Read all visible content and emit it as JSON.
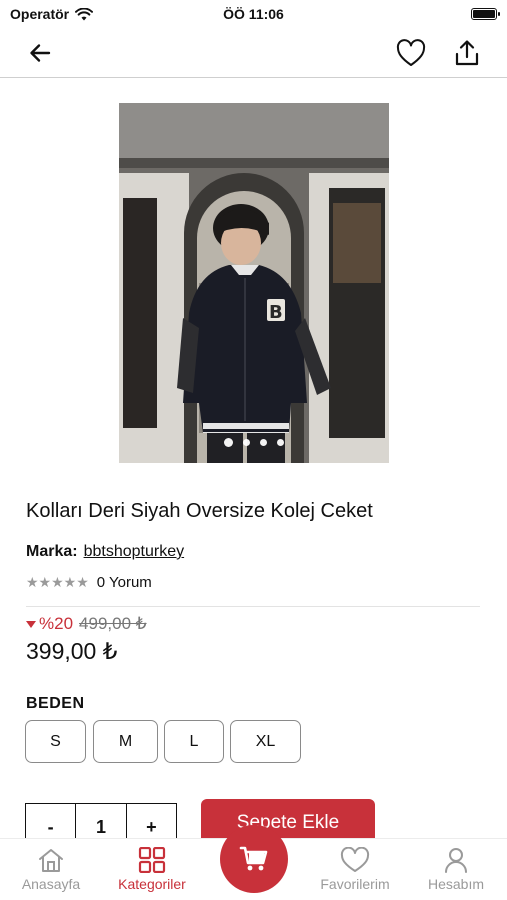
{
  "status_bar": {
    "carrier": "Operatör",
    "time": "ÖÖ 11:06"
  },
  "nav": {
    "back_icon": "arrow-left-icon",
    "favorite_icon": "heart-icon",
    "share_icon": "share-icon"
  },
  "product": {
    "image_alt": "product-photo",
    "image_count": 4,
    "active_image": 1,
    "title": "Kolları Deri Siyah Oversize Kolej Ceket",
    "brand_label": "Marka:",
    "brand": "bbtshopturkey",
    "stars": "★★★★★",
    "rating_value": 0,
    "review_text": "0 Yorum",
    "discount": "%20",
    "old_price": "499,00 ₺",
    "price": "399,00 ₺"
  },
  "sizes": {
    "label": "BEDEN",
    "options": [
      "S",
      "M",
      "L",
      "XL"
    ]
  },
  "cart": {
    "minus": "-",
    "quantity": "1",
    "plus": "+",
    "add_label": "Sepete Ekle"
  },
  "tabs": [
    {
      "label": "Anasayfa",
      "icon": "home-icon"
    },
    {
      "label": "Kategoriler",
      "icon": "grid-icon",
      "active": true
    },
    {
      "label": "",
      "icon": "cart-icon"
    },
    {
      "label": "Favorilerim",
      "icon": "heart-icon"
    },
    {
      "label": "Hesabım",
      "icon": "user-icon"
    }
  ],
  "colors": {
    "accent": "#c8313a",
    "muted": "#9a9a9a",
    "text": "#111111"
  }
}
